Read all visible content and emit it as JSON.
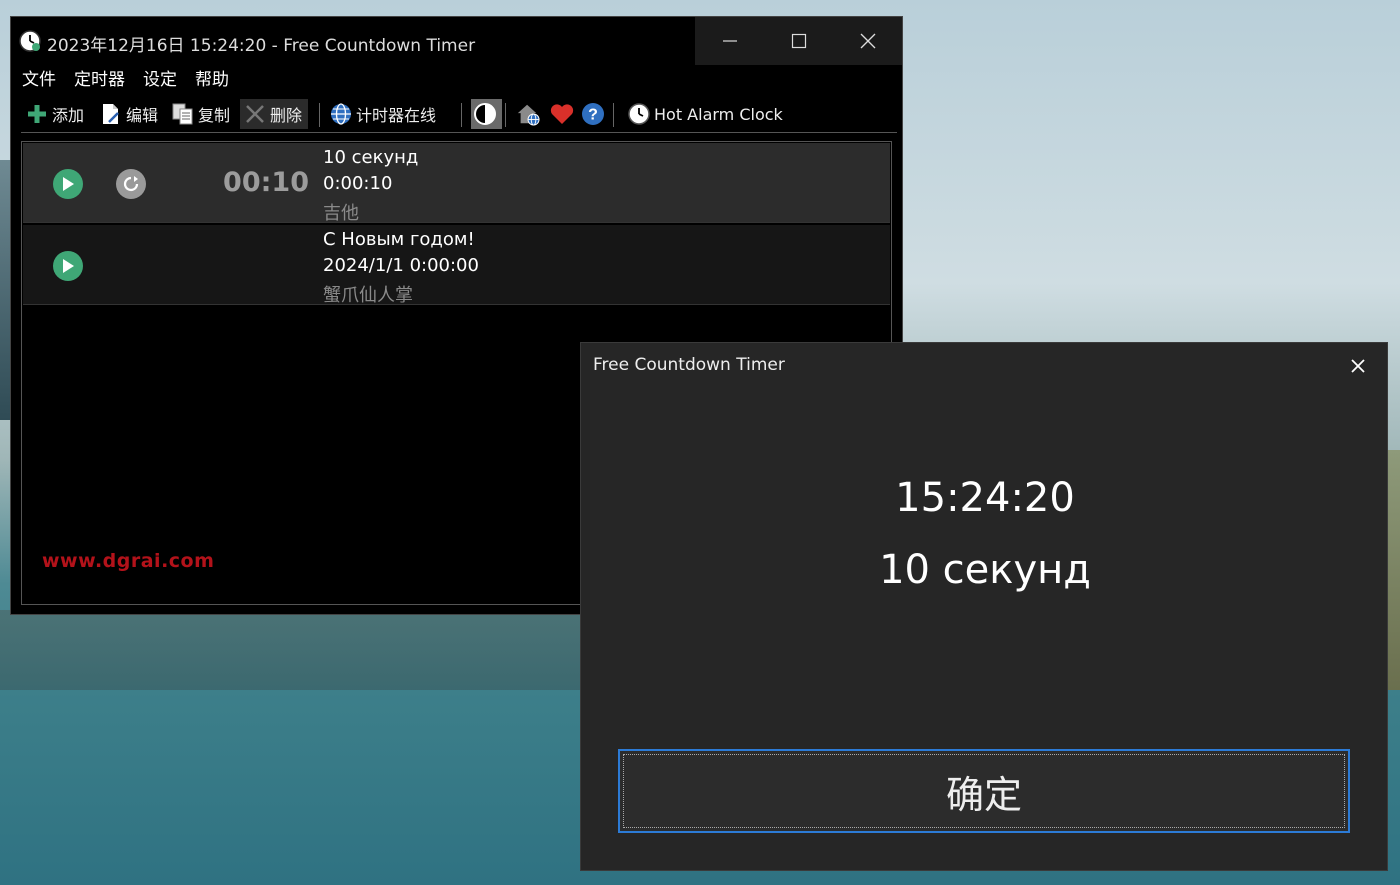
{
  "main_window": {
    "title": "2023年12月16日 15:24:20 - Free Countdown Timer",
    "menu": [
      "文件",
      "定时器",
      "设定",
      "帮助"
    ],
    "toolbar": {
      "add": "添加",
      "edit": "编辑",
      "copy": "复制",
      "delete": "删除",
      "online": "计时器在线",
      "alarm_clock": "Hot Alarm Clock"
    },
    "timers": [
      {
        "countdown": "00:10",
        "name": "10 секунд",
        "time": "0:00:10",
        "sound": "吉他"
      },
      {
        "countdown": "",
        "name": "С Новым годом!",
        "time": "2024/1/1 0:00:00",
        "sound": "蟹爪仙人掌"
      }
    ],
    "watermark": "www.dgrai.com"
  },
  "dialog": {
    "title": "Free Countdown Timer",
    "time": "15:24:20",
    "name": "10 секунд",
    "ok_label": "确定"
  },
  "colors": {
    "play": "#3fa776",
    "repeat": "#9a9a9a",
    "watermark": "#b3121a",
    "focus": "#2c7bd6"
  }
}
